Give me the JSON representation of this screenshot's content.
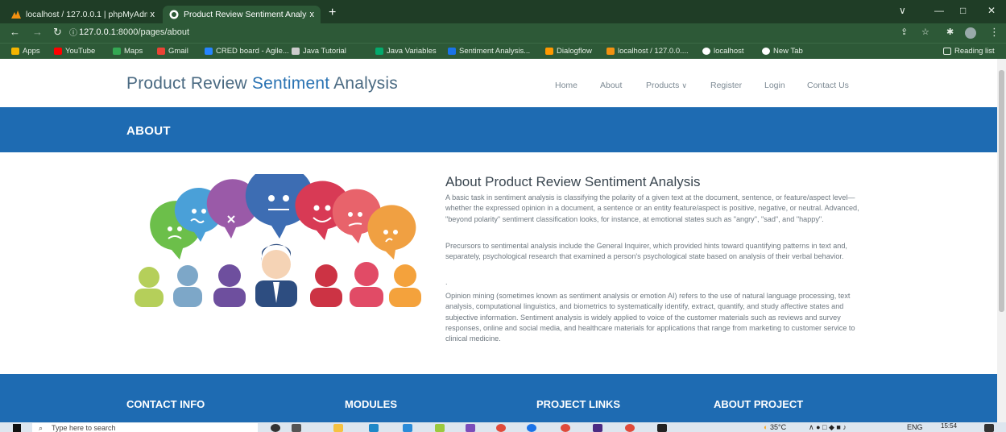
{
  "browser": {
    "tabs": [
      {
        "title": "localhost / 127.0.0.1 | phpMyAdmin",
        "active": false
      },
      {
        "title": "Product Review Sentiment Analysis",
        "active": true
      }
    ],
    "new_tab_glyph": "+",
    "close_glyph": "x",
    "address": {
      "host": "127.0.0.1",
      "path": ":8000/pages/about"
    },
    "bookmarks": [
      {
        "label": "Apps",
        "color": "#f4b400"
      },
      {
        "label": "YouTube",
        "color": "#ff0000"
      },
      {
        "label": "Maps",
        "color": "#34a853"
      },
      {
        "label": "Gmail",
        "color": "#ea4335"
      },
      {
        "label": "CRED board - Agile...",
        "color": "#2684ff"
      },
      {
        "label": "Java Tutorial",
        "color": "#cccccc"
      },
      {
        "label": "Java Variables",
        "color": "#04aa6d"
      },
      {
        "label": "Sentiment Analysis...",
        "color": "#1a73e8"
      },
      {
        "label": "Dialogflow",
        "color": "#ff9800"
      },
      {
        "label": "localhost / 127.0.0....",
        "color": "#f29111"
      },
      {
        "label": "localhost",
        "color": "#ffffff"
      },
      {
        "label": "New Tab",
        "color": "#ffffff"
      }
    ],
    "reading_list": "Reading list"
  },
  "site": {
    "brand_parts": [
      "Product ",
      "Review ",
      "Sentiment ",
      "Analysis"
    ],
    "nav": [
      "Home",
      "About",
      "Products",
      "Register",
      "Login",
      "Contact Us"
    ],
    "products_caret": "∨",
    "banner_title": "ABOUT",
    "about_heading": "About Product Review Sentiment Analysis",
    "paragraphs": [
      "A basic task in sentiment analysis is classifying the polarity of a given text at the document, sentence, or feature/aspect level—whether the expressed opinion in a document, a sentence or an entity feature/aspect is positive, negative, or neutral. Advanced, \"beyond polarity\" sentiment classification looks, for instance, at emotional states such as \"angry\", \"sad\", and \"happy\".",
      "Precursors to sentimental analysis include the General Inquirer, which provided hints toward quantifying patterns in text and, separately, psychological research that examined a person's psychological state based on analysis of their verbal behavior.",
      "Opinion mining (sometimes known as sentiment analysis or emotion AI) refers to the use of natural language processing, text analysis, computational linguistics, and biometrics to systematically identify, extract, quantify, and study affective states and subjective information. Sentiment analysis is widely applied to voice of the customer materials such as reviews and survey responses, online and social media, and healthcare materials for applications that range from marketing to customer service to clinical medicine."
    ],
    "separator": ".",
    "footer_headings": [
      "CONTACT INFO",
      "MODULES",
      "PROJECT LINKS",
      "ABOUT PROJECT"
    ]
  },
  "taskbar": {
    "search_placeholder": "Type here to search",
    "temperature": "35°C",
    "language": "ENG",
    "time": "15:54"
  },
  "colors": {
    "accent_blue": "#1e6bb2",
    "brand_text": "#4a6a82",
    "chrome_green": "#2d5937"
  }
}
